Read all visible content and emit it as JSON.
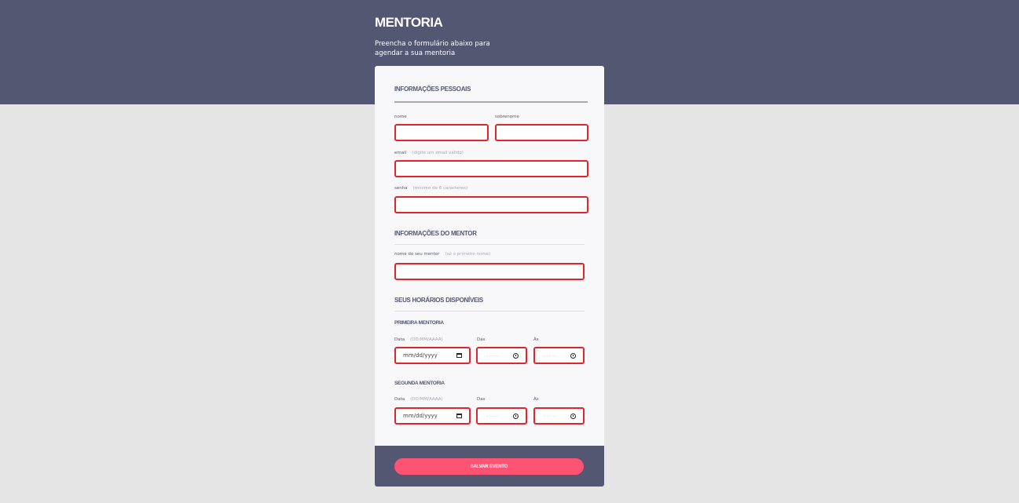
{
  "header": {
    "title": "MENTORIA",
    "subtitle": "Preencha o formulário abaixo para agendar a sua mentoria"
  },
  "personal": {
    "title": "INFORMAÇÕES PESSOAIS",
    "nome_label": "nome",
    "sobrenome_label": "sobrenome",
    "email_label": "email",
    "email_hint": "(digite um email válido)",
    "senha_label": "senha",
    "senha_hint": "(mínimo de 6 caracteres)"
  },
  "mentor": {
    "title": "INFORMAÇÕES DO MENTOR",
    "nome_label": "nome do seu mentor",
    "nome_hint": "(só o primeiro nome)"
  },
  "schedule": {
    "title": "SEUS HORÁRIOS DISPONÍVEIS",
    "sessions": [
      {
        "title": "PRIMEIRA MENTORIA",
        "data_label": "Data",
        "data_hint": "(DD/MM/AAAA)",
        "date_value": "mm/dd/yyyy",
        "das_label": "Das",
        "as_label": "Às",
        "time_placeholder": "--:-- --"
      },
      {
        "title": "SEGUNDA MENTORIA",
        "data_label": "Data",
        "data_hint": "(DD/MM/AAAA)",
        "date_value": "mm/dd/yyyy",
        "das_label": "Das",
        "as_label": "Às",
        "time_placeholder": "--:-- --"
      }
    ]
  },
  "footer": {
    "save_label": "SALVAR EVENTO"
  },
  "icons": {
    "date": "calendar-icon",
    "time": "clock-icon"
  },
  "colors": {
    "header_bg": "#535772",
    "page_bg": "#e5e5e5",
    "card_bg": "#f8f8fb",
    "field_border": "#e3242b",
    "button_bg": "#ff5374"
  }
}
